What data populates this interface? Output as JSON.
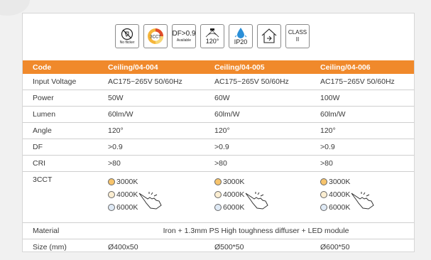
{
  "icons": [
    {
      "name": "no-flicker-icon",
      "label": "No flicker"
    },
    {
      "name": "3cct-icon",
      "label": "3CCT"
    },
    {
      "name": "df-icon",
      "label": "DF>0.9",
      "sub": "Available"
    },
    {
      "name": "beam-angle-icon",
      "label": "120°"
    },
    {
      "name": "ip20-icon",
      "label": "IP20"
    },
    {
      "name": "indoor-icon",
      "label": ""
    },
    {
      "name": "class-ii-icon",
      "label": "CLASS",
      "sub": "II"
    }
  ],
  "table": {
    "headers": [
      "Code",
      "Ceiling/04-004",
      "Ceiling/04-005",
      "Ceiling/04-006"
    ],
    "rows": [
      {
        "label": "Input Voltage",
        "values": [
          "AC175~265V 50/60Hz",
          "AC175~265V 50/60Hz",
          "AC175~265V 50/60Hz"
        ]
      },
      {
        "label": "Power",
        "values": [
          "50W",
          "60W",
          "100W"
        ]
      },
      {
        "label": "Lumen",
        "values": [
          "60lm/W",
          "60lm/W",
          "60lm/W"
        ]
      },
      {
        "label": "Angle",
        "values": [
          "120°",
          "120°",
          "120°"
        ]
      },
      {
        "label": "DF",
        "values": [
          ">0.9",
          ">0.9",
          ">0.9"
        ]
      },
      {
        "label": "CRI",
        "values": [
          ">80",
          ">80",
          ">80"
        ]
      }
    ],
    "cct": {
      "label": "3CCT",
      "options": [
        {
          "text": "3000K",
          "color": "#f7c46c"
        },
        {
          "text": "4000K",
          "color": "#fbeed2"
        },
        {
          "text": "6000K",
          "color": "#dfeaf6"
        }
      ]
    },
    "material": {
      "label": "Material",
      "value": "Iron + 1.3mm PS High toughness diffuser + LED module"
    },
    "size": {
      "label": "Size (mm)",
      "values": [
        "Ø400x50",
        "Ø500*50",
        "Ø600*50"
      ]
    }
  },
  "colors": {
    "header_bg": "#f0892b"
  }
}
